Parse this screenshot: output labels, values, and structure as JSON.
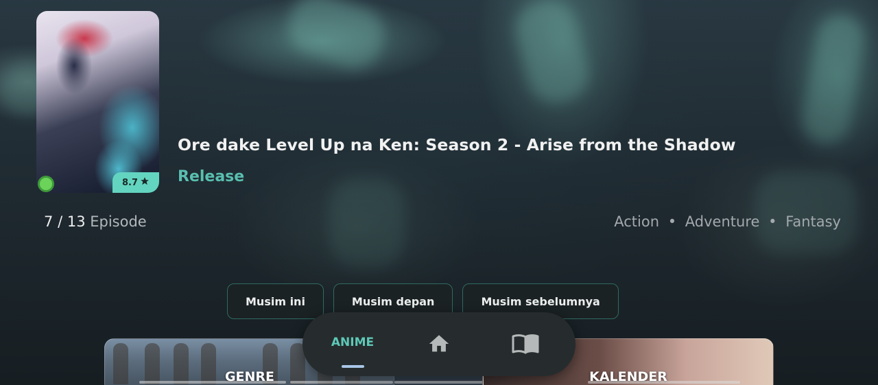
{
  "anime": {
    "title": "Ore dake Level Up na Ken: Season 2 - Arise from the Shadow",
    "status": "Release",
    "rating": "8.7",
    "episodes_current": "7",
    "episodes_separator": "/",
    "episodes_total": "13",
    "episodes_label": "Episode",
    "genres": [
      "Action",
      "Adventure",
      "Fantasy"
    ],
    "genre_separator": "•"
  },
  "season_tabs": [
    {
      "label": "Musim ini"
    },
    {
      "label": "Musim depan"
    },
    {
      "label": "Musim sebelumnya"
    }
  ],
  "cards": {
    "genre_label": "GENRE",
    "kalender_label": "KALENDER"
  },
  "bottom_nav": {
    "anime_label": "ANIME",
    "home_icon": "home-icon",
    "book_icon": "book-open-icon"
  },
  "colors": {
    "accent": "#5ec9b8",
    "rating_badge": "#63d4c0",
    "status_online": "#6cd35a",
    "tab_border": "#2f6b62"
  }
}
